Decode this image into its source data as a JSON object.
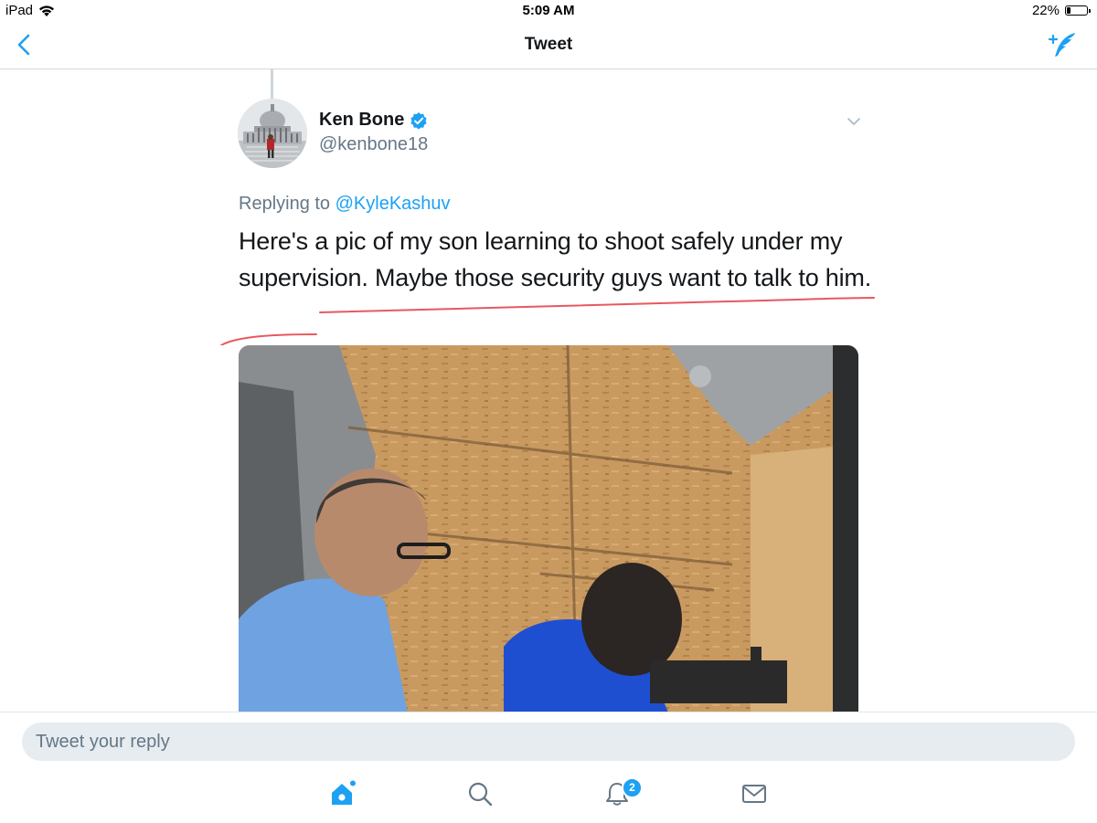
{
  "status_bar": {
    "device": "iPad",
    "time": "5:09 AM",
    "battery": "22%",
    "battery_level": 0.22
  },
  "nav": {
    "title": "Tweet"
  },
  "tweet": {
    "author_name": "Ken Bone",
    "author_handle": "@kenbone18",
    "replying_prefix": "Replying to",
    "replying_to": "@KyleKashuv",
    "text": "Here's a pic of my son learning to shoot safely under my supervision. Maybe those security guys want to talk to him."
  },
  "composer": {
    "placeholder": "Tweet your reply"
  },
  "tab_bar": {
    "notifications_badge": "2"
  },
  "colors": {
    "accent": "#1da1f2",
    "text_primary": "#14171a",
    "text_secondary": "#657786",
    "annotation": "#e0202a"
  }
}
